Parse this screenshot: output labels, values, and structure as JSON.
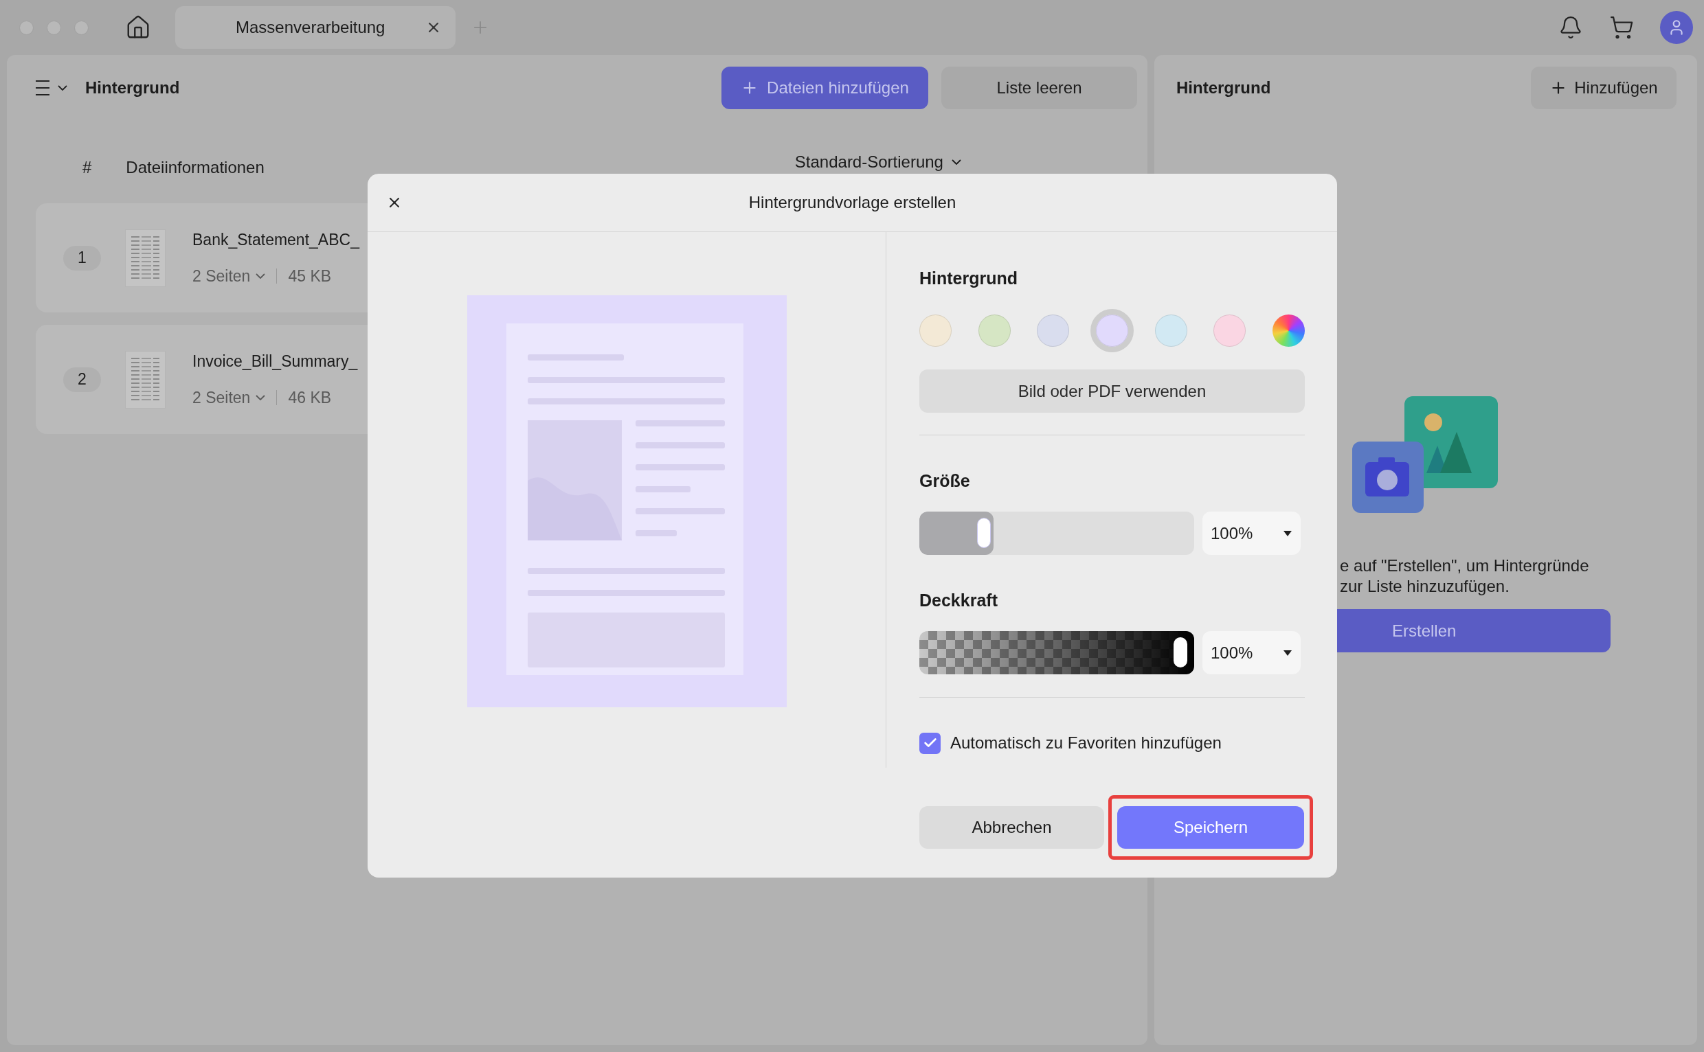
{
  "window": {
    "tab": {
      "title": "Massenverarbeitung"
    }
  },
  "left_panel": {
    "title": "Hintergrund",
    "buttons": [
      {
        "label": "Dateien hinzufügen",
        "kind": "primary"
      },
      {
        "label": "Liste leeren",
        "kind": "secondary"
      }
    ],
    "columns": [
      "#",
      "Dateiinformationen"
    ],
    "sort": "Standard-Sortierung",
    "files": [
      {
        "index": "1",
        "name": "Bank_Statement_ABC_",
        "pages": "2 Seiten",
        "size": "45 KB"
      },
      {
        "index": "2",
        "name": "Invoice_Bill_Summary_",
        "pages": "2 Seiten",
        "size": "46 KB"
      }
    ]
  },
  "right_panel": {
    "title": "Hintergrund",
    "add_button": "Hinzufügen",
    "message_lines": [
      "e auf \"Erstellen\", um Hintergründe",
      "zur Liste hinzuzufügen."
    ],
    "create_button": "Erstellen"
  },
  "dialog": {
    "title": "Hintergrundvorlage erstellen",
    "background_label": "Hintergrund",
    "swatches": [
      {
        "kind": "color",
        "color": "#f3e9d6",
        "selected": false
      },
      {
        "kind": "color",
        "color": "#d6e6c4",
        "selected": false
      },
      {
        "kind": "color",
        "color": "#d9ddee",
        "selected": false
      },
      {
        "kind": "color",
        "color": "#e1dafc",
        "selected": true
      },
      {
        "kind": "color",
        "color": "#d2e9f3",
        "selected": false
      },
      {
        "kind": "color",
        "color": "#fad6e3",
        "selected": false
      },
      {
        "kind": "spectrum",
        "selected": false
      }
    ],
    "image_button": "Bild oder PDF verwenden",
    "size": {
      "label": "Größe",
      "level": 0.27,
      "value": "100%"
    },
    "opacity": {
      "label": "Deckkraft",
      "level": 1,
      "value": "100%"
    },
    "favorite": {
      "label": "Automatisch zu Favoriten hinzufügen",
      "checked": true
    },
    "buttons": [
      {
        "label": "Abbrechen",
        "kind": "secondary",
        "highlighted": false
      },
      {
        "label": "Speichern",
        "kind": "primary",
        "highlighted": true
      }
    ]
  }
}
